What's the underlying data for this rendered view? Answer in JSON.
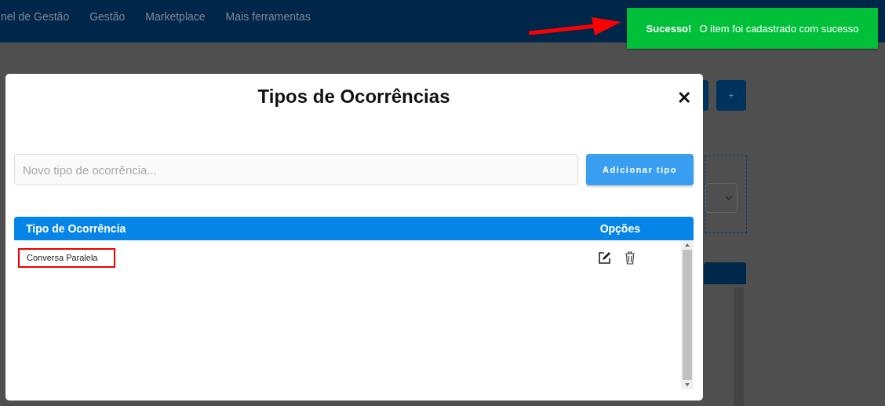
{
  "navbar": {
    "items": [
      {
        "label": "nel de Gestão"
      },
      {
        "label": "Gestão"
      },
      {
        "label": "Marketplace"
      },
      {
        "label": "Mais ferramentas"
      }
    ]
  },
  "page": {
    "add_button": "+"
  },
  "toast": {
    "title": "Sucesso!",
    "message": "O item foi cadastrado com sucesso"
  },
  "modal": {
    "title": "Tipos de Ocorrências",
    "close": "✕",
    "input": {
      "placeholder": "Novo tipo de ocorrência..."
    },
    "add_button": "Adicionar tipo",
    "table": {
      "columns": [
        "Tipo de Ocorrência",
        "Opções"
      ],
      "rows": [
        {
          "name": "Conversa Paralela",
          "highlighted": true
        }
      ]
    }
  }
}
